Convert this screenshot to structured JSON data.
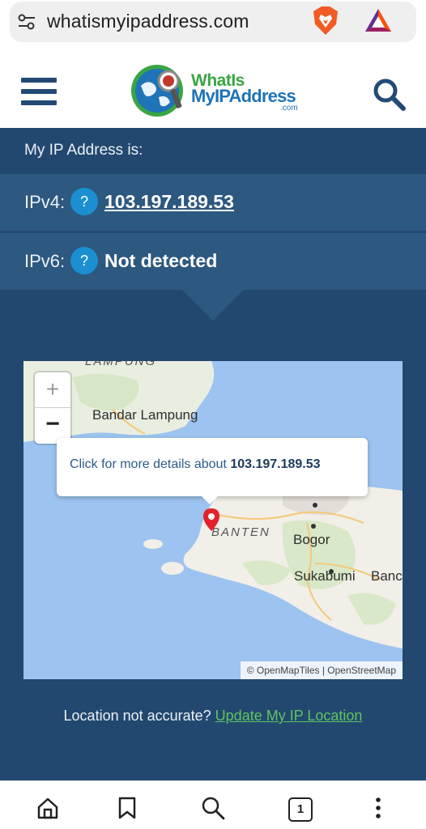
{
  "browser": {
    "url": "whatismyipaddress.com",
    "icons": [
      "tune-icon",
      "brave-lion-icon",
      "bat-rewards-icon"
    ]
  },
  "site": {
    "logo_line1": "WhatIs",
    "logo_line2": "MyIPAddress",
    "logo_suffix": ".com",
    "icons": [
      "hamburger-menu-icon",
      "search-icon"
    ]
  },
  "ip": {
    "heading": "My IP Address is:",
    "ipv4_label": "IPv4:",
    "ipv4_value": "103.197.189.53",
    "ipv6_label": "IPv6:",
    "ipv6_value": "Not detected",
    "help_glyph": "?"
  },
  "map": {
    "zoom_in": "+",
    "zoom_out": "−",
    "labels": {
      "lampung": "LAMPUNG",
      "bandar_lampung": "Bandar Lampung",
      "banten": "BANTEN",
      "bogor": "Bogor",
      "sukabumi": "Sukabumi",
      "bandung_partial": "Banc"
    },
    "popup_prefix": "Click for more details about ",
    "popup_ip": "103.197.189.53",
    "attribution": "© OpenMapTiles | OpenStreetMap"
  },
  "update": {
    "question": "Location not accurate? ",
    "link": "Update My IP Location"
  },
  "bottom_nav": {
    "tab_count": "1",
    "icons": [
      "home-icon",
      "bookmark-icon",
      "search-icon",
      "tabs-icon",
      "more-vertical-icon"
    ]
  },
  "colors": {
    "panel": "#23486f",
    "row": "#2d587f",
    "help": "#1b8fd1",
    "link_green": "#5fc35f",
    "brand_navy": "#234a74"
  }
}
